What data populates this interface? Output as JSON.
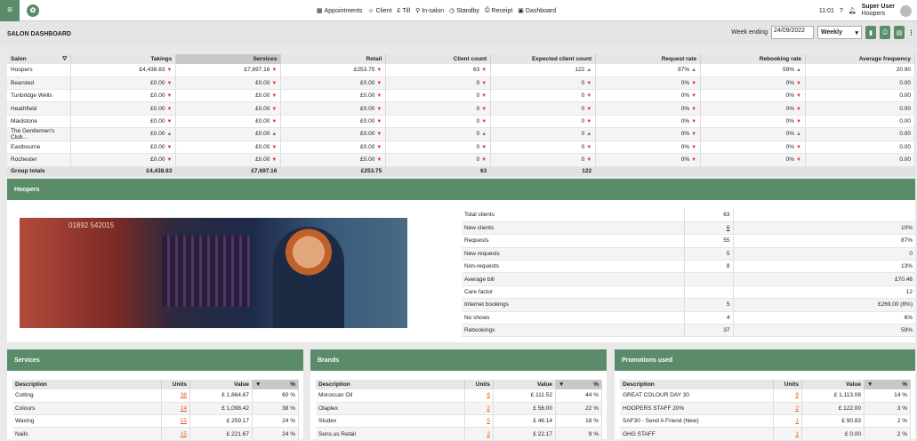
{
  "nav": {
    "items": [
      {
        "icon": "calendar-icon",
        "glyph": "▦",
        "label": "Appointments"
      },
      {
        "icon": "user-icon",
        "glyph": "☺",
        "label": "Client"
      },
      {
        "icon": "pound-icon",
        "glyph": "£",
        "label": "Till"
      },
      {
        "icon": "pin-icon",
        "glyph": "⚲",
        "label": "In-salon"
      },
      {
        "icon": "clock-icon",
        "glyph": "◷",
        "label": "Standby"
      },
      {
        "icon": "printer-icon",
        "glyph": "⎙",
        "label": "Receipt"
      },
      {
        "icon": "dashboard-icon",
        "glyph": "▣",
        "label": "Dashboard"
      }
    ],
    "time": "11:01",
    "user_name": "Super User",
    "user_salon": "Hoopers"
  },
  "header": {
    "title": "SALON DASHBOARD",
    "week_ending_label": "Week ending",
    "week_ending_value": "24/09/2022",
    "period": "Weekly"
  },
  "main_table": {
    "columns": [
      "Salon",
      "Takings",
      "Services",
      "Retail",
      "Client count",
      "Expected client count",
      "Request rate",
      "Rebooking rate",
      "Average frequency"
    ],
    "rows": [
      [
        "Hoopers",
        "£4,438.83",
        "£7,697.16",
        "£253.75",
        "63",
        "122",
        "87%",
        "59%",
        "20.90"
      ],
      [
        "Bearsted",
        "£0.00",
        "£0.00",
        "£0.00",
        "0",
        "0",
        "0%",
        "0%",
        "0.00"
      ],
      [
        "Tunbridge Wells",
        "£0.00",
        "£0.00",
        "£0.00",
        "0",
        "0",
        "0%",
        "0%",
        "0.00"
      ],
      [
        "Heathfield",
        "£0.00",
        "£0.00",
        "£0.00",
        "0",
        "0",
        "0%",
        "0%",
        "0.00"
      ],
      [
        "Maidstone",
        "£0.00",
        "£0.00",
        "£0.00",
        "0",
        "0",
        "0%",
        "0%",
        "0.00"
      ],
      [
        "The Gentlemen's Club...",
        "£0.00",
        "£0.00",
        "£0.00",
        "0",
        "0",
        "0%",
        "0%",
        "0.00"
      ],
      [
        "Eastbourne",
        "£0.00",
        "£0.00",
        "£0.00",
        "0",
        "0",
        "0%",
        "0%",
        "0.00"
      ],
      [
        "Rochester",
        "£0.00",
        "£0.00",
        "£0.00",
        "0",
        "0",
        "0%",
        "0%",
        "0.00"
      ]
    ],
    "arrows": [
      [
        "dn",
        "dn",
        "dn",
        "dn",
        "up",
        "up",
        "up",
        ""
      ],
      [
        "dn",
        "dn",
        "dn",
        "dn",
        "dn",
        "dn",
        "dn",
        ""
      ],
      [
        "dn",
        "dn",
        "dn",
        "dn",
        "dn",
        "dn",
        "dn",
        ""
      ],
      [
        "dn",
        "dn",
        "dn",
        "dn",
        "dn",
        "dn",
        "dn",
        ""
      ],
      [
        "dn",
        "dn",
        "dn",
        "dn",
        "dn",
        "dn",
        "dn",
        ""
      ],
      [
        "up",
        "up",
        "dn",
        "up",
        "up",
        "dn",
        "up",
        ""
      ],
      [
        "dn",
        "dn",
        "dn",
        "dn",
        "dn",
        "dn",
        "dn",
        ""
      ],
      [
        "dn",
        "dn",
        "dn",
        "dn",
        "dn",
        "dn",
        "dn",
        ""
      ]
    ],
    "totals": [
      "Group totals",
      "£4,438.83",
      "£7,697.16",
      "£253.75",
      "63",
      "122",
      "",
      "",
      ""
    ]
  },
  "salon_panel": {
    "title": "Hoopers",
    "photo_phone": "01892 542015",
    "stats": [
      [
        "Total clients",
        "63",
        ""
      ],
      [
        "New clients",
        "6",
        "10%"
      ],
      [
        "Requests",
        "55",
        "87%"
      ],
      [
        "New requests",
        "5",
        "0"
      ],
      [
        "Non-requests",
        "8",
        "13%"
      ],
      [
        "Average bill",
        "",
        "£70.46"
      ],
      [
        "Care factor",
        "",
        "12"
      ],
      [
        "Internet bookings",
        "5",
        "£269.00 (8%)"
      ],
      [
        "No shows",
        "4",
        "6%"
      ],
      [
        "Rebookings",
        "37",
        "59%"
      ]
    ]
  },
  "services": {
    "title": "Services",
    "columns": [
      "Description",
      "Units",
      "Value",
      "%"
    ],
    "rows": [
      [
        "Cutting",
        "38",
        "£ 1,864.67",
        "60 %"
      ],
      [
        "Colours",
        "24",
        "£ 1,098.42",
        "38 %"
      ],
      [
        "Waxing",
        "15",
        "£ 259.17",
        "24 %"
      ],
      [
        "Nails",
        "15",
        "£ 221.67",
        "24 %"
      ]
    ]
  },
  "brands": {
    "title": "Brands",
    "columns": [
      "Description",
      "Units",
      "Value",
      "%"
    ],
    "rows": [
      [
        "Moroccan Oil",
        "6",
        "£ 111.52",
        "44 %"
      ],
      [
        "Olaplex",
        "2",
        "£ 56.00",
        "22 %"
      ],
      [
        "Studex",
        "5",
        "£ 46.14",
        "18 %"
      ],
      [
        "Sens.us Retail",
        "2",
        "£ 22.17",
        "9 %"
      ]
    ]
  },
  "promotions": {
    "title": "Promotions used",
    "columns": [
      "Description",
      "Units",
      "Value",
      "%"
    ],
    "rows": [
      [
        "GREAT COLOUR DAY 30",
        "9",
        "£ 1,113.08",
        "14 %"
      ],
      [
        "HOOPERS STAFF 20%",
        "2",
        "£ 122.00",
        "3 %"
      ],
      [
        "SAF30 - Send A Friend (New)",
        "1",
        "£ 90.83",
        "2 %"
      ],
      [
        "GHG STAFF",
        "1",
        "£ 0.00",
        "2 %"
      ]
    ]
  }
}
